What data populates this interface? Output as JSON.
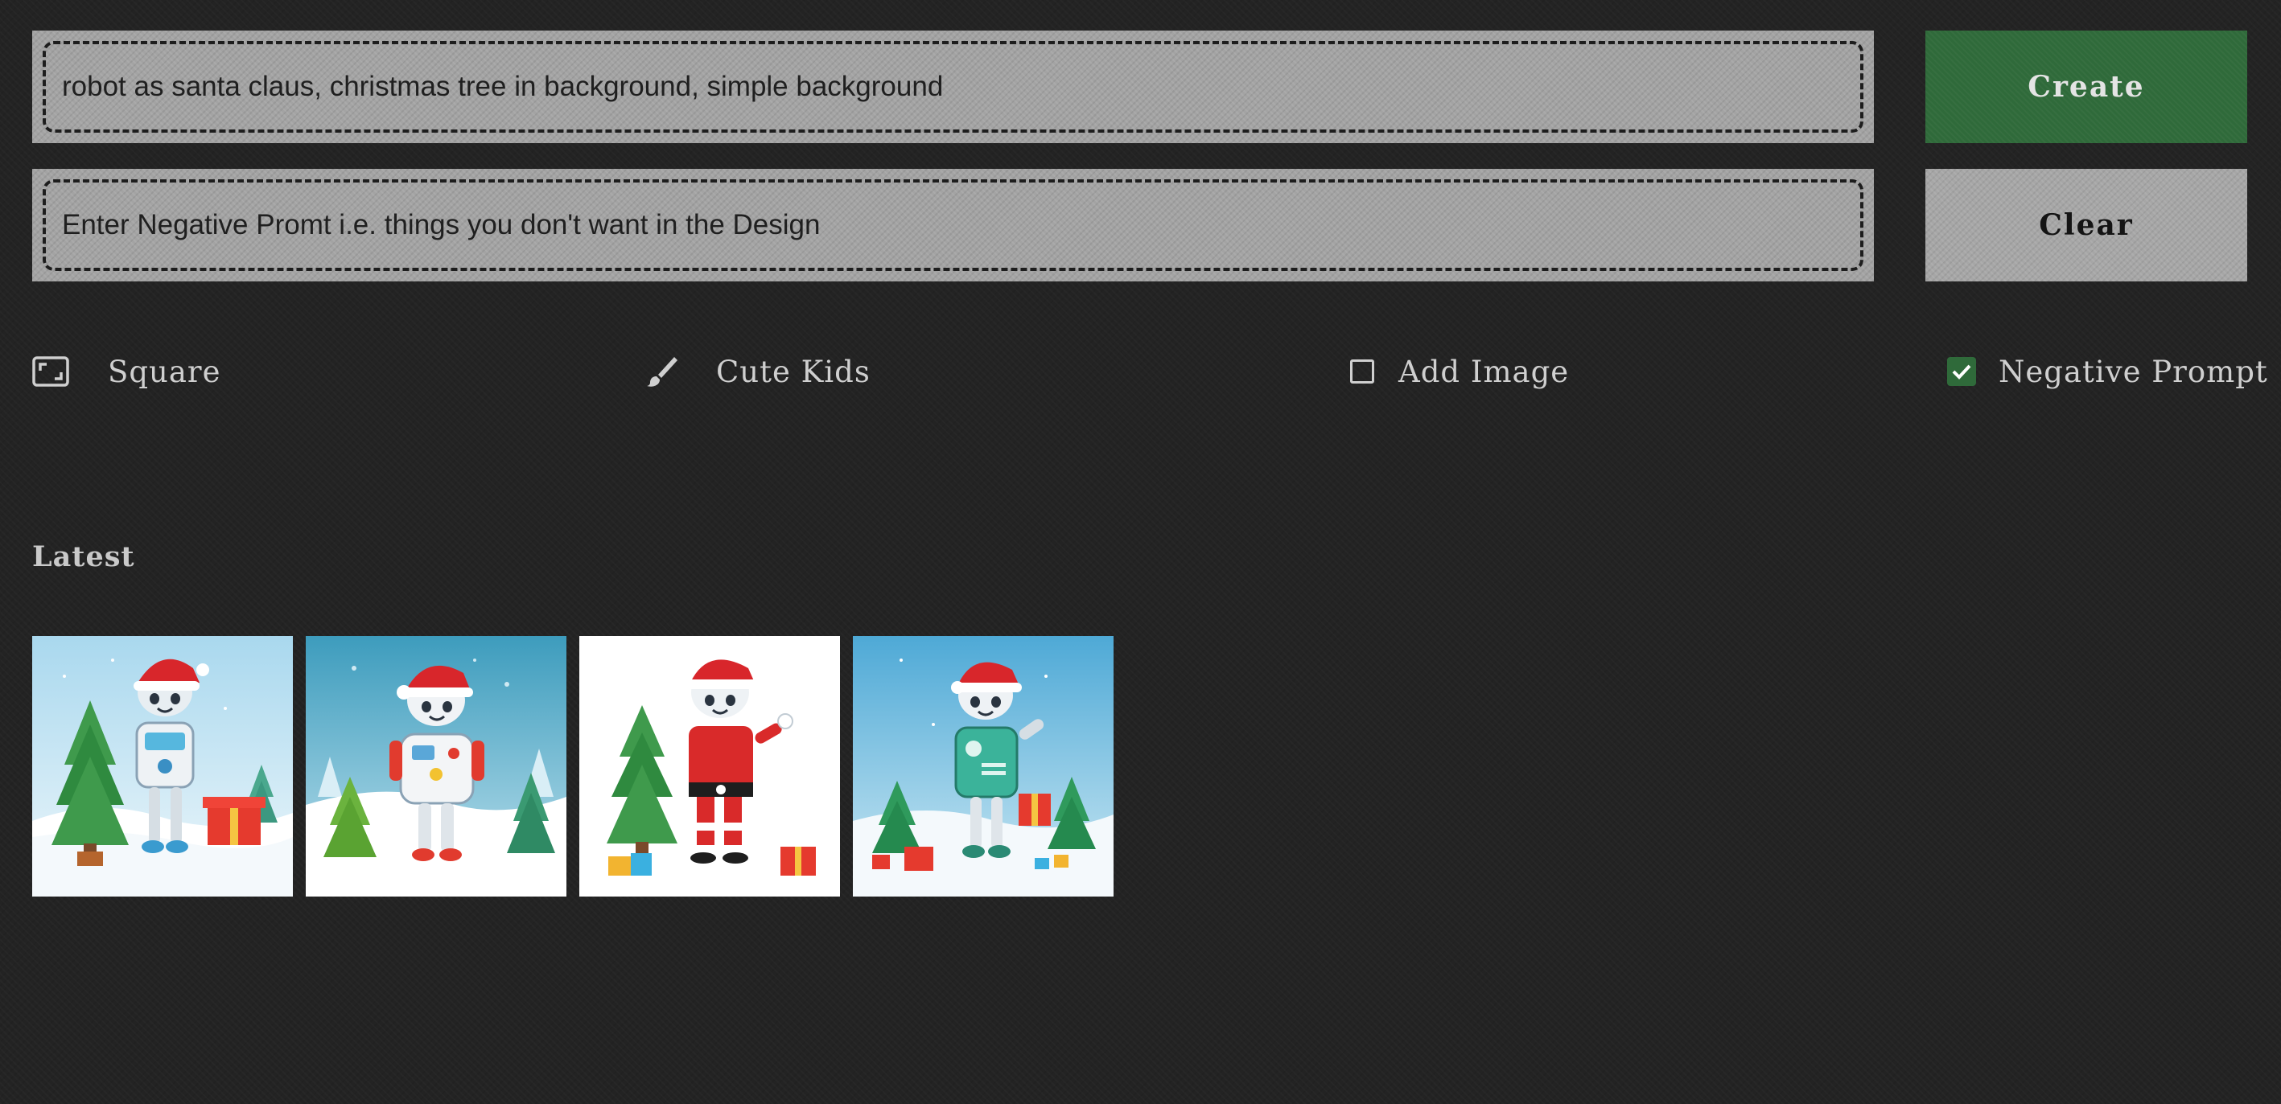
{
  "prompt": {
    "value": "robot as santa claus, christmas tree in background, simple background"
  },
  "negative_prompt": {
    "placeholder": "Enter Negative Promt i.e. things you don't want in the Design"
  },
  "actions": {
    "create_label": "Create",
    "clear_label": "Clear"
  },
  "options": {
    "aspect": {
      "label": "Square",
      "icon": "aspect-ratio-icon"
    },
    "style": {
      "label": "Cute Kids",
      "icon": "paintbrush-icon"
    },
    "add_image": {
      "label": "Add Image",
      "checked": false
    },
    "negative_prompt_toggle": {
      "label": "Negative Prompt",
      "checked": true
    }
  },
  "latest": {
    "title": "Latest",
    "images": [
      {
        "name": "robot-santa-blue-sky-gift",
        "theme": "light-blue"
      },
      {
        "name": "robot-santa-teal-sky-front",
        "theme": "teal"
      },
      {
        "name": "robot-santa-red-suit-white",
        "theme": "white"
      },
      {
        "name": "robot-santa-green-body-wave",
        "theme": "blue"
      }
    ]
  },
  "colors": {
    "background": "#232323",
    "accent_green": "#2f6a3a",
    "field_gray": "#a3a3a3",
    "text_light": "#cfcfcf"
  }
}
